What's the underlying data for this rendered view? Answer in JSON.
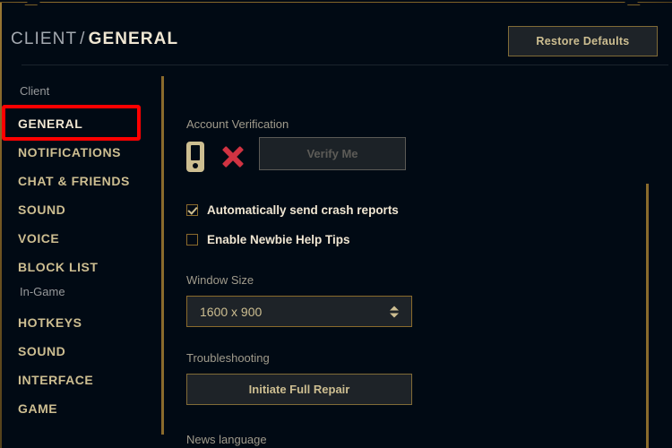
{
  "header": {
    "breadcrumb_root": "CLIENT",
    "breadcrumb_separator": "/",
    "breadcrumb_current": "GENERAL",
    "restore_defaults_label": "Restore Defaults"
  },
  "sidebar": {
    "groups": [
      {
        "label": "Client",
        "items": [
          {
            "label": "GENERAL",
            "active": true
          },
          {
            "label": "NOTIFICATIONS",
            "active": false
          },
          {
            "label": "CHAT & FRIENDS",
            "active": false
          },
          {
            "label": "SOUND",
            "active": false
          },
          {
            "label": "VOICE",
            "active": false
          },
          {
            "label": "BLOCK LIST",
            "active": false
          }
        ]
      },
      {
        "label": "In-Game",
        "items": [
          {
            "label": "HOTKEYS",
            "active": false
          },
          {
            "label": "SOUND",
            "active": false
          },
          {
            "label": "INTERFACE",
            "active": false
          },
          {
            "label": "GAME",
            "active": false
          }
        ]
      }
    ]
  },
  "main": {
    "account_verification": {
      "label": "Account Verification",
      "phone_icon": "phone-icon",
      "status_icon": "x-mark-icon",
      "status": "unverified",
      "verify_button_label": "Verify Me",
      "verify_button_disabled": true
    },
    "checkboxes": [
      {
        "label": "Automatically send crash reports",
        "checked": true
      },
      {
        "label": "Enable Newbie Help Tips",
        "checked": false
      }
    ],
    "window_size": {
      "label": "Window Size",
      "value": "1600 x 900"
    },
    "troubleshooting": {
      "label": "Troubleshooting",
      "repair_button_label": "Initiate Full Repair"
    },
    "news_language": {
      "label": "News language"
    }
  },
  "colors": {
    "background": "#010a14",
    "gold": "#cdbe91",
    "gold_border": "#8a6b2c",
    "bright_text": "#f0e6d2",
    "muted_text": "#a09b8c",
    "panel": "#1e2328",
    "danger": "#d13342",
    "annotation": "#ff0000"
  }
}
